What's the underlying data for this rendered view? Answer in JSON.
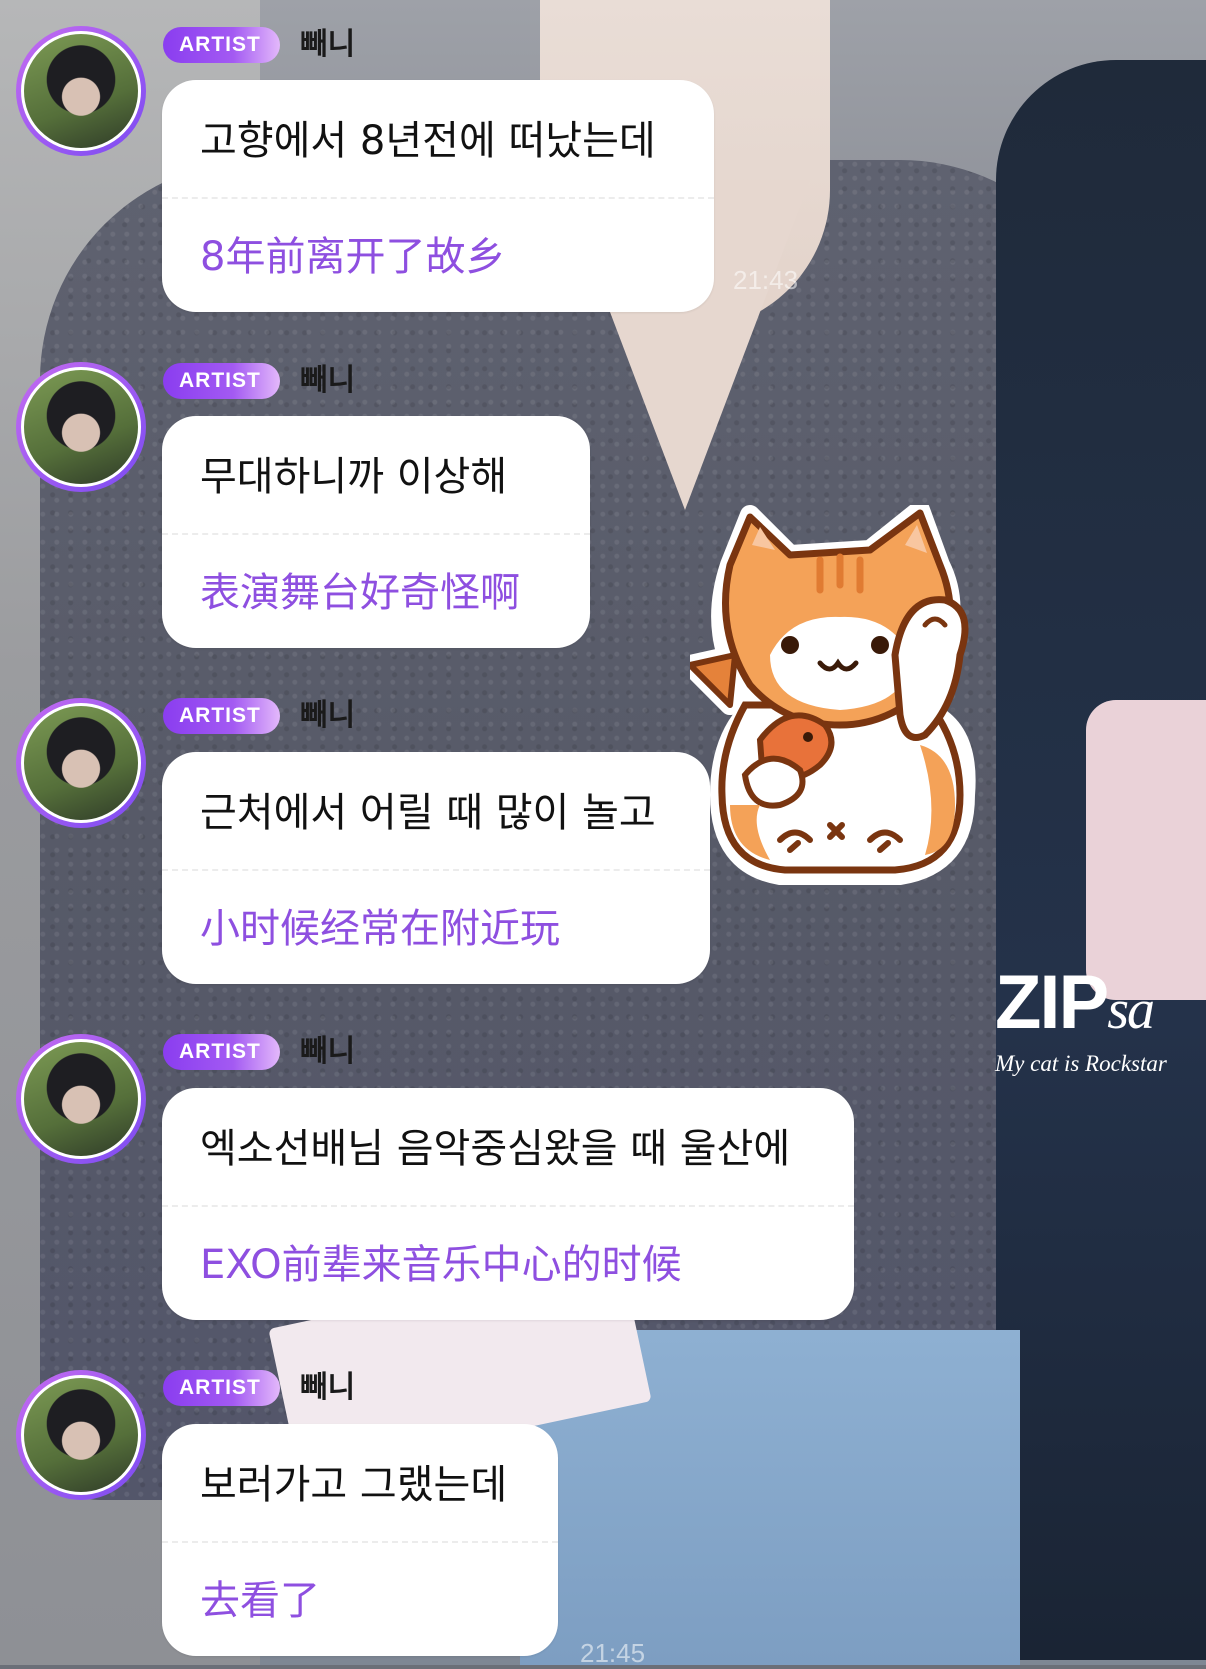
{
  "colors": {
    "badge_start": "#8a3df0",
    "badge_end": "#e3b8fb",
    "translation_text": "#8e4fe0",
    "bubble_bg": "#ffffff"
  },
  "messages": [
    {
      "badge": "ARTIST",
      "name": "빼니",
      "korean": "고향에서 8년전에 떠났는데",
      "chinese": "8年前离开了故乡"
    },
    {
      "badge": "ARTIST",
      "name": "빼니",
      "korean": "무대하니까 이상해",
      "chinese": "表演舞台好奇怪啊"
    },
    {
      "badge": "ARTIST",
      "name": "빼니",
      "korean": "근처에서 어릴 때 많이 놀고",
      "chinese": "小时候经常在附近玩"
    },
    {
      "badge": "ARTIST",
      "name": "빼니",
      "korean": "엑소선배님 음악중심왔을 때 울산에",
      "chinese": "EXO前辈来音乐中心的时候"
    },
    {
      "badge": "ARTIST",
      "name": "빼니",
      "korean": "보러가고 그랬는데",
      "chinese": "去看了"
    }
  ],
  "timestamps": [
    "21:43",
    "21:45"
  ],
  "watermark": {
    "brand": "ZIP",
    "brand_suffix": "sa",
    "tagline": "My cat is Rockstar"
  },
  "sticker": {
    "icon": "lucky-cat-sticker-icon"
  }
}
